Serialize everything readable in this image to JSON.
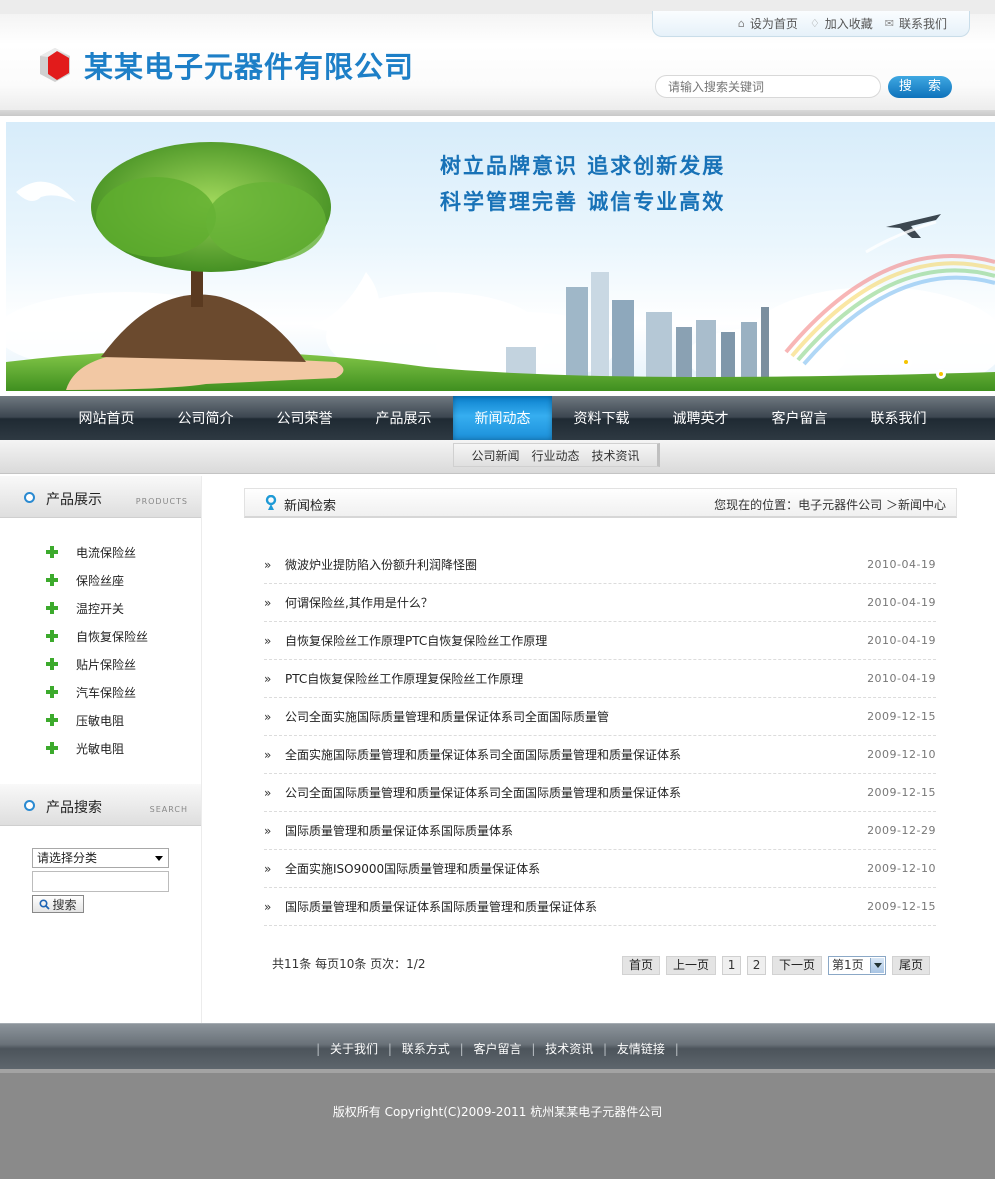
{
  "header": {
    "company_name": "某某电子元器件有限公司",
    "top_links": [
      {
        "label": "设为首页",
        "icon": "home-icon"
      },
      {
        "label": "加入收藏",
        "icon": "bookmark-icon"
      },
      {
        "label": "联系我们",
        "icon": "contact-icon"
      }
    ],
    "search_placeholder": "请输入搜索关键词",
    "search_button": "搜 索"
  },
  "banner": {
    "slogan_line1": "树立品牌意识   追求创新发展",
    "slogan_line2": "科学管理完善   诚信专业高效"
  },
  "nav": {
    "items": [
      "网站首页",
      "公司简介",
      "公司荣誉",
      "产品展示",
      "新闻动态",
      "资料下载",
      "诚聘英才",
      "客户留言",
      "联系我们"
    ],
    "active": "新闻动态",
    "sub_items": [
      "公司新闻",
      "行业动态",
      "技术资讯"
    ]
  },
  "sidebar": {
    "products_title": "产品展示",
    "products_title_en": "PRODUCTS",
    "products": [
      "电流保险丝",
      "保险丝座",
      "温控开关",
      "自恢复保险丝",
      "贴片保险丝",
      "汽车保险丝",
      "压敏电阻",
      "光敏电阻"
    ],
    "search_title": "产品搜索",
    "search_title_en": "SEARCH",
    "category_select": "请选择分类",
    "search_button": "搜索"
  },
  "main": {
    "section_title": "新闻检索",
    "breadcrumb": "您现在的位置：电子元器件公司 ＞新闻中心",
    "news": [
      {
        "title": "微波炉业提防陷入份额升利润降怪圈",
        "date": "2010-04-19"
      },
      {
        "title": "何谓保险丝,其作用是什么？",
        "date": "2010-04-19"
      },
      {
        "title": "自恢复保险丝工作原理PTC自恢复保险丝工作原理",
        "date": "2010-04-19"
      },
      {
        "title": "PTC自恢复保险丝工作原理复保险丝工作原理",
        "date": "2010-04-19"
      },
      {
        "title": "公司全面实施国际质量管理和质量保证体系司全面国际质量管",
        "date": "2009-12-15"
      },
      {
        "title": "全面实施国际质量管理和质量保证体系司全面国际质量管理和质量保证体系",
        "date": "2009-12-10"
      },
      {
        "title": "公司全面国际质量管理和质量保证体系司全面国际质量管理和质量保证体系",
        "date": "2009-12-15"
      },
      {
        "title": "国际质量管理和质量保证体系国际质量体系",
        "date": "2009-12-29"
      },
      {
        "title": "全面实施ISO9000国际质量管理和质量保证体系",
        "date": "2009-12-10"
      },
      {
        "title": "国际质量管理和质量保证体系国际质量管理和质量保证体系",
        "date": "2009-12-15"
      }
    ],
    "pager": {
      "info": "共11条  每页10条  页次：1/2",
      "first": "首页",
      "prev": "上一页",
      "pages": [
        "1",
        "2"
      ],
      "next": "下一页",
      "jump_select": "第1页",
      "last": "尾页"
    }
  },
  "footer": {
    "links": [
      "关于我们",
      "联系方式",
      "客户留言",
      "技术资讯",
      "友情链接"
    ],
    "copyright": "版权所有  Copyright(C)2009-2011 杭州某某电子元器件公司"
  },
  "colors": {
    "brand_blue": "#1d7fc7",
    "nav_active": "#1b8fd9",
    "plus_green": "#3caa2c"
  }
}
